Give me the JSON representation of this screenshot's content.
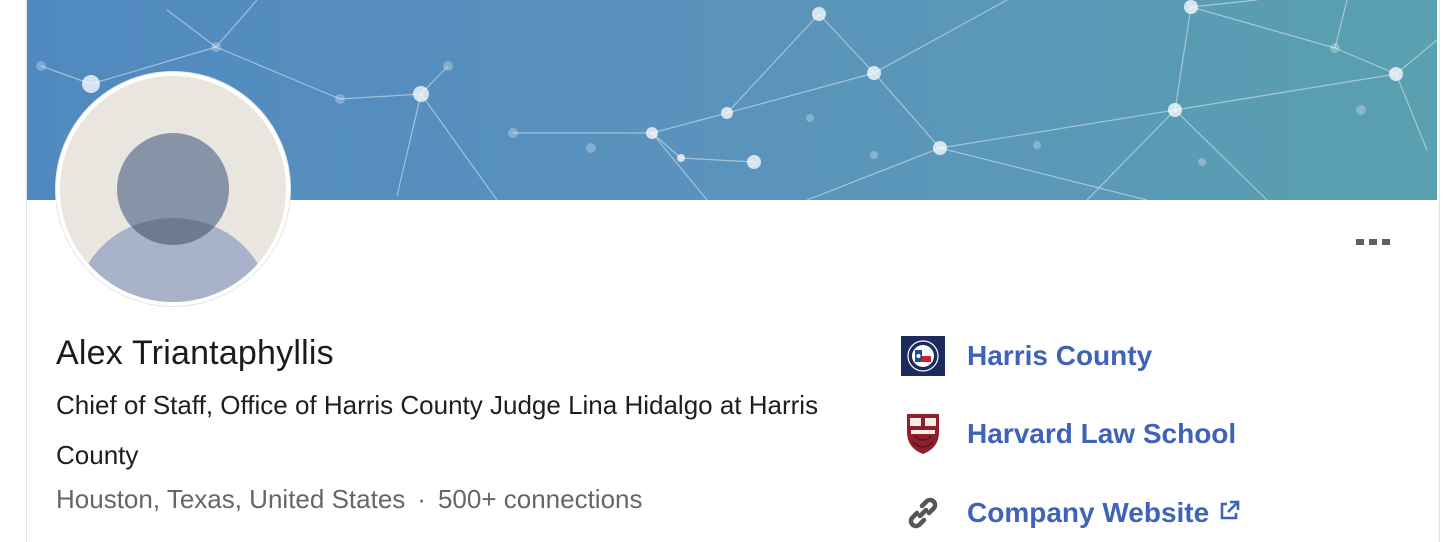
{
  "profile": {
    "name": "Alex Triantaphyllis",
    "headline": "Chief of Staff, Office of Harris County Judge Lina Hidalgo at Harris County",
    "location": "Houston, Texas, United States",
    "separator": "·",
    "connections": "500+ connections"
  },
  "sidebar": {
    "items": [
      {
        "label": "Harris County",
        "icon": "harris-county-seal-icon"
      },
      {
        "label": "Harvard Law School",
        "icon": "harvard-shield-icon"
      },
      {
        "label": "Company Website",
        "icon": "link-icon",
        "trailing_icon": "external-link-icon"
      }
    ]
  },
  "actions": {
    "more_icon": "more-horizontal-icon"
  },
  "colors": {
    "link": "#3f63b8",
    "banner_start": "#5089bf",
    "banner_end": "#5aa0b0",
    "text_primary": "#1b1b1b",
    "text_secondary": "#666666"
  }
}
